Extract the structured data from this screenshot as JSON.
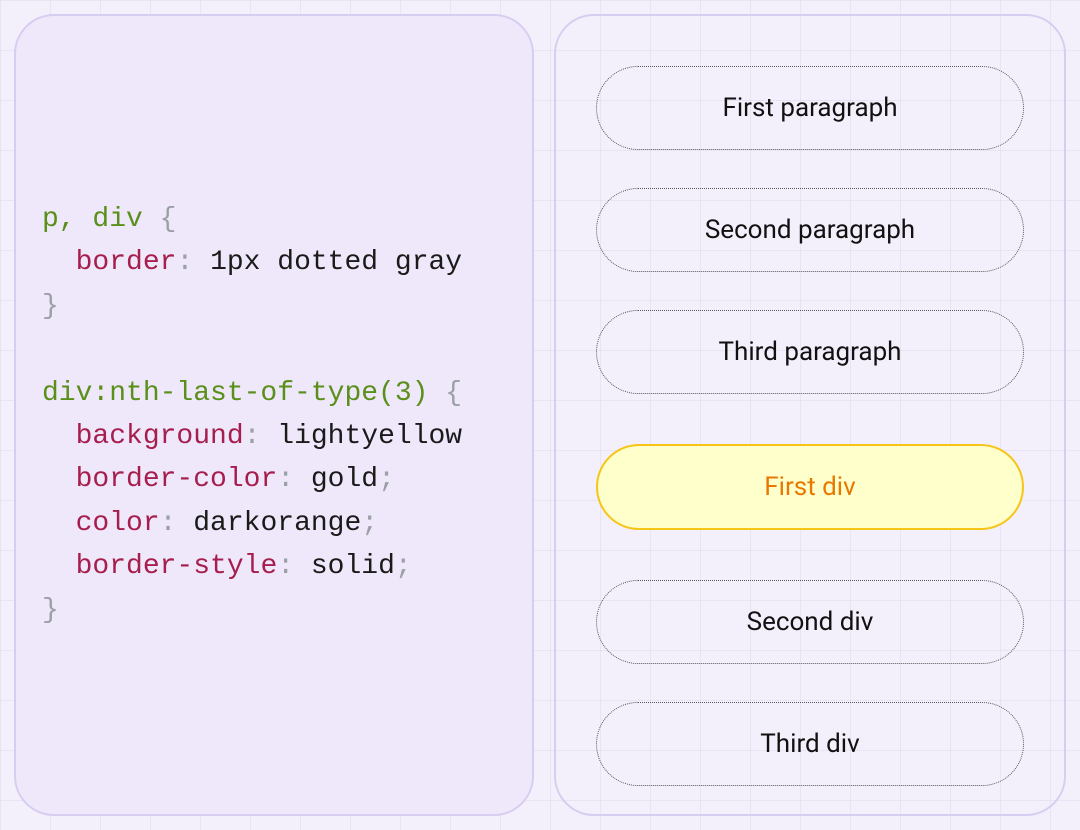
{
  "code": {
    "rule1": {
      "selector": "p, div",
      "decls": [
        {
          "prop": "border",
          "value": "1px dotted gray",
          "semicolon": false
        }
      ]
    },
    "rule2": {
      "selector": "div:nth-last-of-type(3)",
      "decls": [
        {
          "prop": "background",
          "value": "lightyellow",
          "semicolon": false
        },
        {
          "prop": "border-color",
          "value": "gold",
          "semicolon": true
        },
        {
          "prop": "color",
          "value": "darkorange",
          "semicolon": true
        },
        {
          "prop": "border-style",
          "value": "solid",
          "semicolon": true
        }
      ]
    }
  },
  "output": {
    "items": [
      {
        "label": "First paragraph",
        "highlight": false
      },
      {
        "label": "Second paragraph",
        "highlight": false
      },
      {
        "label": "Third paragraph",
        "highlight": false
      },
      {
        "label": "First div",
        "highlight": true
      },
      {
        "label": "Second div",
        "highlight": false
      },
      {
        "label": "Third div",
        "highlight": false
      }
    ]
  }
}
